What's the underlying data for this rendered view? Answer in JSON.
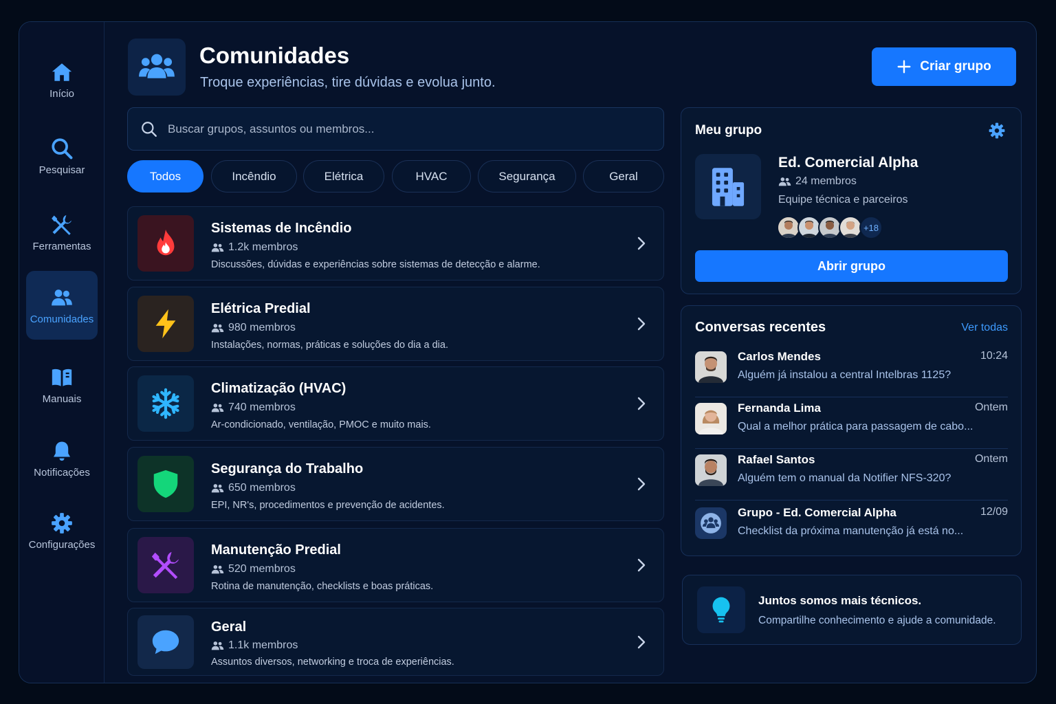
{
  "sidebar": {
    "items": [
      {
        "label": "Início",
        "icon": "home-icon"
      },
      {
        "label": "Pesquisar",
        "icon": "search-icon"
      },
      {
        "label": "Ferramentas",
        "icon": "tools-icon"
      },
      {
        "label": "Comunidades",
        "icon": "users-icon",
        "active": true
      },
      {
        "label": "Manuais",
        "icon": "book-icon"
      },
      {
        "label": "Notificações",
        "icon": "bell-icon"
      },
      {
        "label": "Configurações",
        "icon": "gear-icon"
      }
    ]
  },
  "header": {
    "title": "Comunidades",
    "subtitle": "Troque experiências, tire dúvidas e evolua junto.",
    "create_button": "Criar grupo"
  },
  "search": {
    "placeholder": "Buscar grupos, assuntos ou membros..."
  },
  "filters": [
    "Todos",
    "Incêndio",
    "Elétrica",
    "HVAC",
    "Segurança",
    "Geral"
  ],
  "communities": [
    {
      "title": "Sistemas de Incêndio",
      "members": "1.2k membros",
      "description": "Discussões, dúvidas e experiências sobre sistemas de detecção e alarme.",
      "icon": "flame-icon",
      "color": "#ff3b3b"
    },
    {
      "title": "Elétrica Predial",
      "members": "980 membros",
      "description": "Instalações, normas, práticas e soluções do dia a dia.",
      "icon": "bolt-icon",
      "color": "#ffc21a"
    },
    {
      "title": "Climatização (HVAC)",
      "members": "740 membros",
      "description": "Ar-condicionado, ventilação, PMOC e muito mais.",
      "icon": "snowflake-icon",
      "color": "#2fb6ff"
    },
    {
      "title": "Segurança do Trabalho",
      "members": "650 membros",
      "description": "EPI, NR's, procedimentos e prevenção de acidentes.",
      "icon": "shield-icon",
      "color": "#14d67a"
    },
    {
      "title": "Manutenção Predial",
      "members": "520 membros",
      "description": "Rotina de manutenção, checklists e boas práticas.",
      "icon": "tools-icon",
      "color": "#b24dff"
    },
    {
      "title": "Geral",
      "members": "1.1k membros",
      "description": "Assuntos diversos, networking e troca de experiências.",
      "icon": "chat-icon",
      "color": "#4aa3ff"
    }
  ],
  "my_group": {
    "heading": "Meu grupo",
    "name": "Ed. Comercial Alpha",
    "members": "24 membros",
    "description": "Equipe técnica e parceiros",
    "more_members": "+18",
    "open_button": "Abrir grupo"
  },
  "recent": {
    "heading": "Conversas recentes",
    "see_all": "Ver todas",
    "items": [
      {
        "name": "Carlos Mendes",
        "time": "10:24",
        "message": "Alguém já instalou a central Intelbras 1125?"
      },
      {
        "name": "Fernanda Lima",
        "time": "Ontem",
        "message": "Qual a melhor prática para passagem de cabo..."
      },
      {
        "name": "Rafael Santos",
        "time": "Ontem",
        "message": "Alguém tem o manual da Notifier NFS-320?"
      },
      {
        "name": "Grupo - Ed. Comercial Alpha",
        "time": "12/09",
        "message": "Checklist da próxima manutenção já está no..."
      }
    ]
  },
  "tip": {
    "title": "Juntos somos mais técnicos.",
    "subtitle": "Compartilhe conhecimento e ajude a comunidade."
  },
  "colors": {
    "accent": "#1677ff",
    "background": "#06122a",
    "link": "#3e9bff"
  }
}
